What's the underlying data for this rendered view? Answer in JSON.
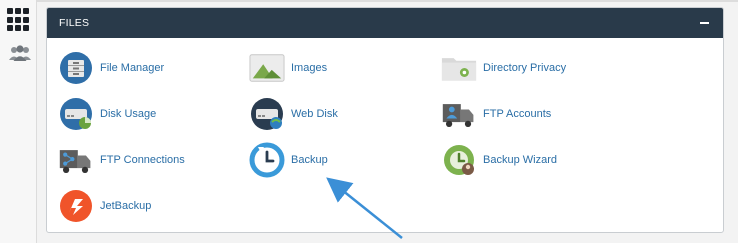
{
  "sidebar": {
    "icons": [
      {
        "name": "grid-icon"
      },
      {
        "name": "users-icon"
      }
    ]
  },
  "files_panel": {
    "title": "FILES",
    "collapse_icon": "minus-icon",
    "items": [
      {
        "label": "File Manager",
        "icon": "file-manager-icon"
      },
      {
        "label": "Images",
        "icon": "images-icon"
      },
      {
        "label": "Directory Privacy",
        "icon": "directory-privacy-icon"
      },
      {
        "label": "Disk Usage",
        "icon": "disk-usage-icon"
      },
      {
        "label": "Web Disk",
        "icon": "web-disk-icon"
      },
      {
        "label": "FTP Accounts",
        "icon": "ftp-accounts-icon"
      },
      {
        "label": "FTP Connections",
        "icon": "ftp-connections-icon"
      },
      {
        "label": "Backup",
        "icon": "backup-icon"
      },
      {
        "label": "Backup Wizard",
        "icon": "backup-wizard-icon"
      },
      {
        "label": "JetBackup",
        "icon": "jetbackup-icon"
      }
    ]
  },
  "colors": {
    "header_bg": "#293a4a",
    "link": "#2a6ea6",
    "annotation_arrow": "#3b8fd6"
  }
}
